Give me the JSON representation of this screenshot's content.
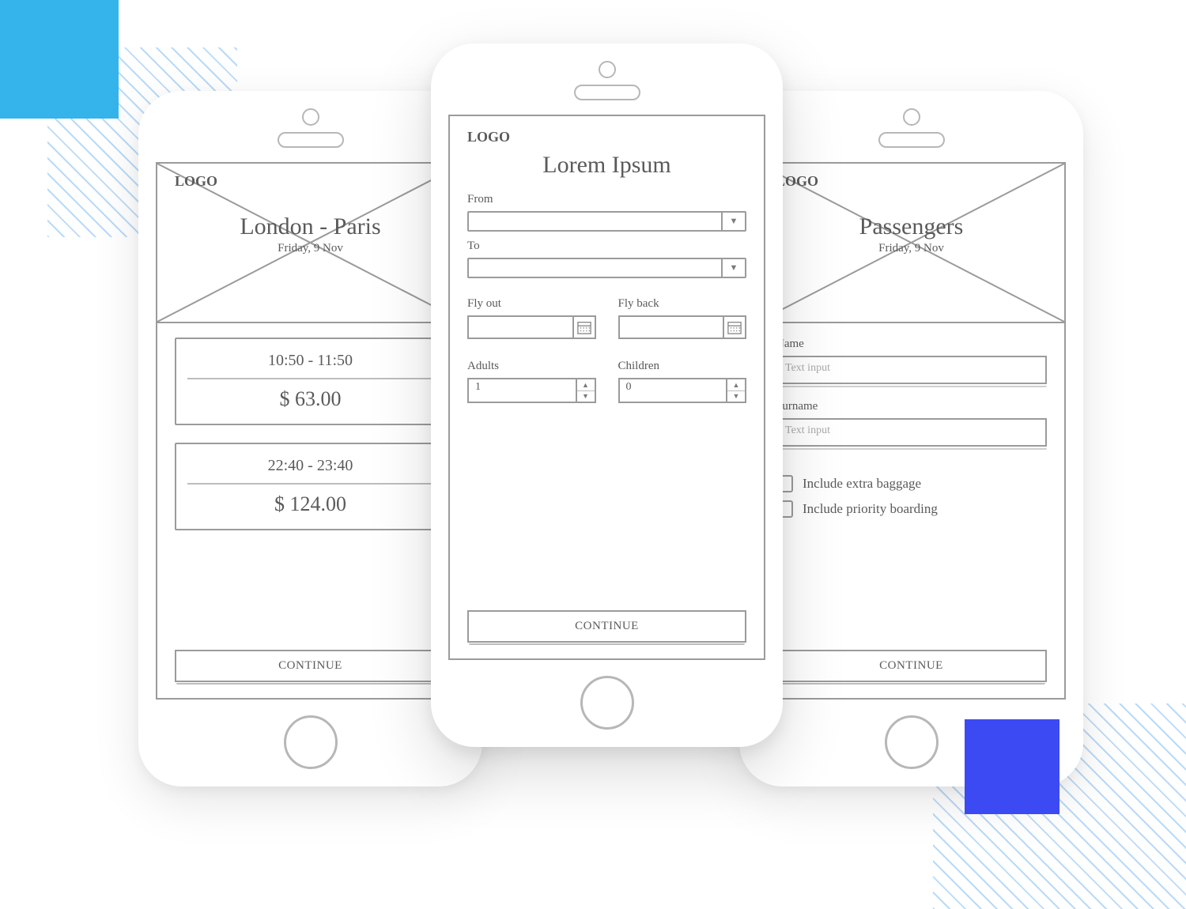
{
  "common": {
    "logo": "LOGO",
    "continue": "CONTINUE"
  },
  "screen1": {
    "title": "London - Paris",
    "subtitle": "Friday, 9 Nov",
    "flights": [
      {
        "time": "10:50 - 11:50",
        "price": "$ 63.00"
      },
      {
        "time": "22:40 - 23:40",
        "price": "$ 124.00"
      }
    ]
  },
  "screen2": {
    "title": "Lorem Ipsum",
    "labels": {
      "from": "From",
      "to": "To",
      "flyout": "Fly out",
      "flyback": "Fly back",
      "adults": "Adults",
      "children": "Children"
    },
    "adults": "1",
    "children": "0"
  },
  "screen3": {
    "title": "Passengers",
    "subtitle": "Friday, 9 Nov",
    "labels": {
      "name": "Name",
      "surname": "Surname"
    },
    "placeholders": {
      "name": "Text input",
      "surname": "Text input"
    },
    "options": {
      "baggage": "Include extra baggage",
      "priority": "Include priority boarding"
    }
  }
}
